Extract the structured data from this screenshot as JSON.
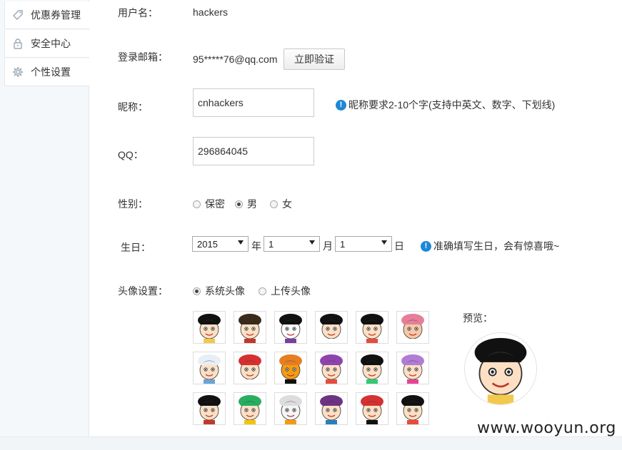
{
  "sidebar": {
    "items": [
      {
        "label": "优惠券管理",
        "icon": "tag-icon"
      },
      {
        "label": "安全中心",
        "icon": "lock-icon"
      },
      {
        "label": "个性设置",
        "icon": "gear-icon"
      }
    ]
  },
  "form": {
    "username": {
      "label": "用户名：",
      "value": "hackers"
    },
    "email": {
      "label": "登录邮箱：",
      "value": "95*****76@qq.com",
      "verify_button": "立即验证"
    },
    "nickname": {
      "label": "昵称：",
      "value": "cnhackers",
      "tip": "昵称要求2-10个字(支持中英文、数字、下划线)"
    },
    "qq": {
      "label": "QQ：",
      "value": "296864045"
    },
    "gender": {
      "label": "性别：",
      "options": [
        "保密",
        "男",
        "女"
      ],
      "selected": "男"
    },
    "birthday": {
      "label": "生日：",
      "year": "2015",
      "year_unit": "年",
      "month": "1",
      "month_unit": "月",
      "day": "1",
      "day_unit": "日",
      "tip": "准确填写生日，会有惊喜哦~"
    },
    "avatar": {
      "label": "头像设置：",
      "options": [
        "系统头像",
        "上传头像"
      ],
      "selected": "系统头像",
      "preview_label": "预览："
    }
  },
  "avatars": [
    {
      "name": "straw-hat-boy",
      "face": "#fde0c4",
      "hair": "#111111",
      "accent": "#f2c94c"
    },
    {
      "name": "qing-official",
      "face": "#fde0c4",
      "hair": "#3a2a1a",
      "accent": "#c0392b"
    },
    {
      "name": "no-face",
      "face": "#ffffff",
      "hair": "#111111",
      "accent": "#7b3fa0"
    },
    {
      "name": "spiky-hair-boy",
      "face": "#fde0c4",
      "hair": "#111111",
      "accent": "#ffffff"
    },
    {
      "name": "shin-chan",
      "face": "#fde0c4",
      "hair": "#111111",
      "accent": "#e74c3c"
    },
    {
      "name": "reindeer-doctor",
      "face": "#f6c9a8",
      "hair": "#e67e9a",
      "accent": "#ffffff"
    },
    {
      "name": "white-hair-dog-ears",
      "face": "#fde0c4",
      "hair": "#e8eef5",
      "accent": "#6ba3d8"
    },
    {
      "name": "red-hood-girl",
      "face": "#fde0c4",
      "hair": "#d63031",
      "accent": "#ffffff"
    },
    {
      "name": "orange-cat",
      "face": "#f39c12",
      "hair": "#e67e22",
      "accent": "#111111"
    },
    {
      "name": "flower-girl",
      "face": "#fde0c4",
      "hair": "#8e44ad",
      "accent": "#e74c3c"
    },
    {
      "name": "twin-bun-girl",
      "face": "#fde0c4",
      "hair": "#111111",
      "accent": "#2ecc71"
    },
    {
      "name": "purple-hair-girl",
      "face": "#fde0c4",
      "hair": "#b07cd6",
      "accent": "#e84393"
    },
    {
      "name": "top-hat-gentleman",
      "face": "#fde0c4",
      "hair": "#111111",
      "accent": "#c0392b"
    },
    {
      "name": "green-hair-girl",
      "face": "#fde0c4",
      "hair": "#27ae60",
      "accent": "#f1c40f"
    },
    {
      "name": "white-duck",
      "face": "#f5f5f5",
      "hair": "#dddddd",
      "accent": "#f39c12"
    },
    {
      "name": "glasses-kid",
      "face": "#fde0c4",
      "hair": "#6c3483",
      "accent": "#2980b9"
    },
    {
      "name": "mario",
      "face": "#fde0c4",
      "hair": "#d63031",
      "accent": "#111111"
    },
    {
      "name": "bowl-cut-kid",
      "face": "#fde0c4",
      "hair": "#111111",
      "accent": "#e74c3c"
    }
  ],
  "watermark": "www.wooyun.org",
  "colors": {
    "tip_icon": "#1e88d6",
    "sidebar_bg": "#f5f8fb"
  }
}
